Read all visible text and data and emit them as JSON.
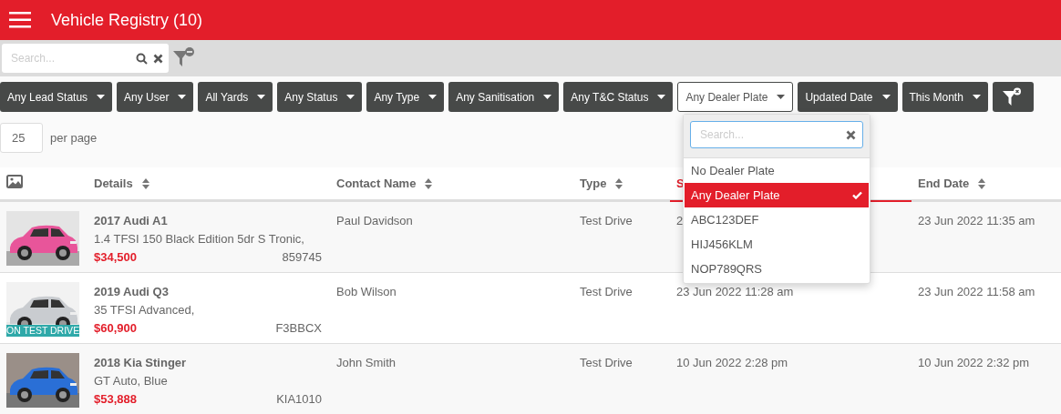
{
  "app_bar": {
    "title": "Vehicle Registry (10)"
  },
  "search": {
    "placeholder": "Search..."
  },
  "filters": [
    {
      "label": "Any Lead Status",
      "open": false
    },
    {
      "label": "Any User",
      "open": false
    },
    {
      "label": "All Yards",
      "open": false
    },
    {
      "label": "Any Status",
      "open": false
    },
    {
      "label": "Any Type",
      "open": false
    },
    {
      "label": "Any Sanitisation",
      "open": false
    },
    {
      "label": "Any T&C Status",
      "open": false
    },
    {
      "label": "Any Dealer Plate",
      "open": true
    },
    {
      "label": "Updated Date",
      "open": false
    },
    {
      "label": "This Month",
      "open": false
    }
  ],
  "per_page": {
    "value": "25",
    "label": "per page"
  },
  "table": {
    "columns": [
      {
        "kind": "icon",
        "sorted": false
      },
      {
        "kind": "text",
        "label": "Details",
        "sorted": false
      },
      {
        "kind": "text",
        "label": "Contact Name",
        "sorted": false
      },
      {
        "kind": "text",
        "label": "Type",
        "sorted": false
      },
      {
        "kind": "text",
        "label": "S",
        "sorted": true
      },
      {
        "kind": "text",
        "label": "End Date",
        "sorted": false
      }
    ],
    "rows": [
      {
        "title": "2017 Audi A1",
        "description": "1.4 TFSI 150 Black Edition 5dr S Tronic,",
        "price": "$34,500",
        "stock_number": "859745",
        "contact_name": "Paul Davidson",
        "type": "Test Drive",
        "start_date": "2",
        "end_date": "23 Jun 2022 11:35 am"
      },
      {
        "title": "2019 Audi Q3",
        "description": "35 TFSI Advanced,",
        "price": "$60,900",
        "stock_number": "F3BBCX",
        "contact_name": "Bob Wilson",
        "type": "Test Drive",
        "start_date": "23 Jun 2022 11:28 am",
        "end_date": "23 Jun 2022 11:58 am",
        "badge": "ON TEST DRIVE"
      },
      {
        "title": "2018 Kia Stinger",
        "description": "GT Auto, Blue",
        "price": "$53,888",
        "stock_number": "KIA1010",
        "contact_name": "John Smith",
        "type": "Test Drive",
        "start_date": "10 Jun 2022 2:28 pm",
        "end_date": "10 Jun 2022 2:32 pm"
      }
    ]
  },
  "dropdown": {
    "search_placeholder": "Search...",
    "options": [
      {
        "label": "No Dealer Plate",
        "selected": false
      },
      {
        "label": "Any Dealer Plate",
        "selected": true
      },
      {
        "label": "ABC123DEF",
        "selected": false
      },
      {
        "label": "HIJ456KLM",
        "selected": false
      },
      {
        "label": "NOP789QRS",
        "selected": false
      }
    ]
  }
}
